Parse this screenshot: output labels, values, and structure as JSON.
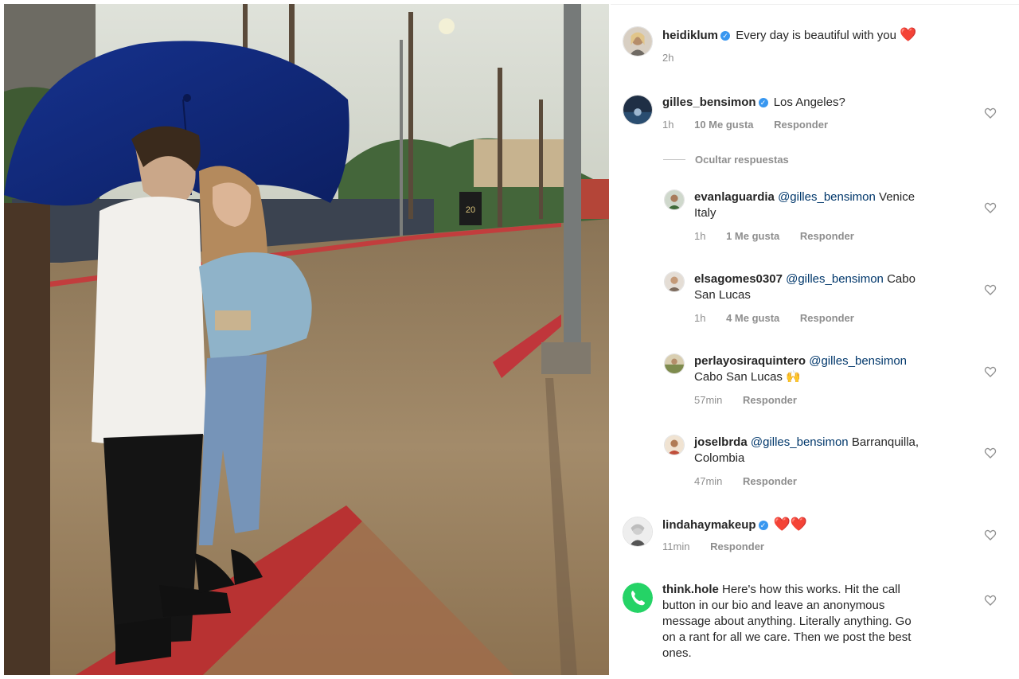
{
  "photo": {
    "sign_text": "20"
  },
  "post": {
    "username": "heidiklum",
    "caption": "Every day is beautiful with you",
    "emoji": "❤️",
    "time": "2h"
  },
  "hide_replies_label": "Ocultar respuestas",
  "comments": [
    {
      "username": "gilles_bensimon",
      "text": "Los Angeles?",
      "time": "1h",
      "likes": "10 Me gusta",
      "reply_label": "Responder"
    },
    {
      "username": "evanlaguardia",
      "mention": "@gilles_bensimon",
      "text_line1": "Venice",
      "text_line2": "Italy",
      "time": "1h",
      "likes": "1 Me gusta",
      "reply_label": "Responder"
    },
    {
      "username": "elsagomes0307",
      "mention": "@gilles_bensimon",
      "text_line1": "Cabo",
      "text_line2": "San Lucas",
      "time": "1h",
      "likes": "4 Me gusta",
      "reply_label": "Responder"
    },
    {
      "username": "perlayosiraquintero",
      "mention": "@gilles_bensimon",
      "text_line2": "Cabo San Lucas",
      "emoji": "🙌",
      "time": "57min",
      "reply_label": "Responder"
    },
    {
      "username": "joselbrda",
      "mention": "@gilles_bensimon",
      "text_line1": "Barranquilla,",
      "text_line2": "Colombia",
      "time": "47min",
      "reply_label": "Responder"
    },
    {
      "username": "lindahaymakeup",
      "emoji": "❤️❤️",
      "time": "11min",
      "reply_label": "Responder"
    },
    {
      "username": "think.hole",
      "lines": [
        "Here's how this works. Hit the call",
        "button in our bio and leave an anonymous",
        "message about anything. Literally anything. Go",
        "on a rant for all we care. Then we post the best",
        "ones."
      ]
    }
  ],
  "colors": {
    "mention": "#00376b",
    "verified": "#3897f0",
    "heart": "#ed4956",
    "meta": "#8e8e8e",
    "whatsapp_green": "#25d366"
  }
}
